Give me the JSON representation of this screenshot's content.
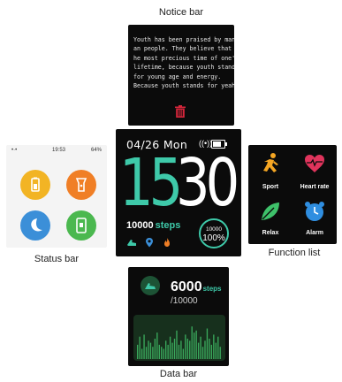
{
  "captions": {
    "notice": "Notice bar",
    "status": "Status bar",
    "function": "Function list",
    "data": "Data bar"
  },
  "notice": {
    "lines": [
      "Youth has been praised by many",
      "an people. They believe that it t",
      "he most precious time of one's",
      "lifetime, because youth stands",
      "for young age and energy.",
      "Because youth stands  for yeah"
    ],
    "icon": "trash-icon",
    "icon_color": "#d6263b"
  },
  "main": {
    "date": "04/26",
    "weekday": "Mon",
    "hour": "15",
    "minute": "30",
    "steps_value": "10000",
    "steps_unit": "steps",
    "goal": "10000",
    "goal_percent": "100%",
    "accent": "#3ec9a9",
    "icons": [
      "shoe-icon",
      "location-icon",
      "flame-icon"
    ]
  },
  "status": {
    "bar_left": "•·•",
    "time": "19:53",
    "battery": "64%",
    "buttons": [
      {
        "name": "battery-icon",
        "color": "#f2b424"
      },
      {
        "name": "flashlight-icon",
        "color": "#f07f26"
      },
      {
        "name": "moon-icon",
        "color": "#3b8fd8"
      },
      {
        "name": "phone-icon",
        "color": "#4bb84f"
      }
    ]
  },
  "functions": {
    "items": [
      {
        "label": "Sport",
        "icon": "running-icon",
        "color": "#f5a623"
      },
      {
        "label": "Heart rate",
        "icon": "heart-icon",
        "color": "#e0345c"
      },
      {
        "label": "Relax",
        "icon": "leaf-icon",
        "color": "#3ec16a"
      },
      {
        "label": "Alarm",
        "icon": "alarm-clock-icon",
        "color": "#2f8ee0"
      }
    ]
  },
  "databar": {
    "value": "6000",
    "unit": "steps",
    "target": "/10000",
    "icon": "shoe-icon",
    "bars": [
      0.35,
      0.55,
      0.25,
      0.6,
      0.3,
      0.45,
      0.4,
      0.3,
      0.5,
      0.65,
      0.35,
      0.3,
      0.25,
      0.45,
      0.35,
      0.55,
      0.4,
      0.5,
      0.7,
      0.35,
      0.45,
      0.25,
      0.6,
      0.5,
      0.45,
      0.8,
      0.65,
      0.7,
      0.4,
      0.55,
      0.3,
      0.45,
      0.75,
      0.5,
      0.35,
      0.6,
      0.4,
      0.55,
      0.3
    ]
  }
}
